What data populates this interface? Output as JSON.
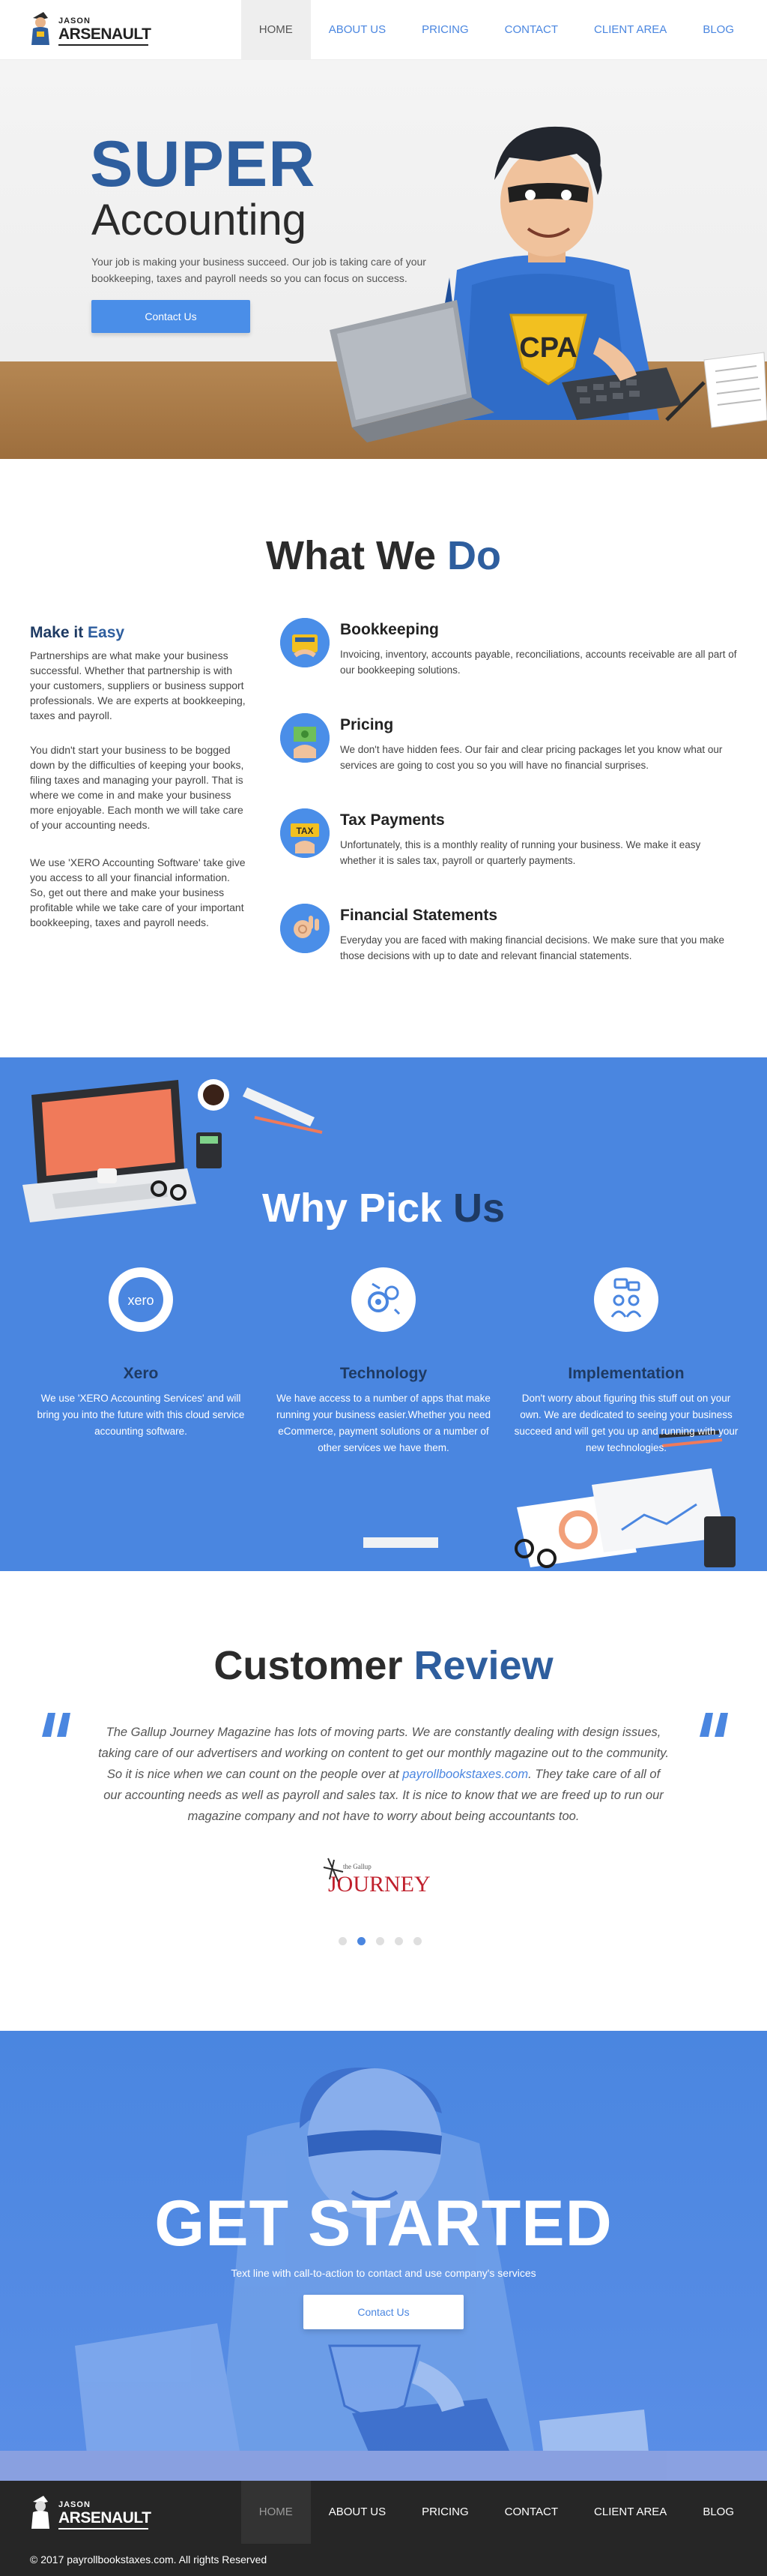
{
  "header": {
    "logo": {
      "first": "JASON",
      "last": "ARSENAULT"
    },
    "nav": [
      {
        "label": "HOME",
        "active": true
      },
      {
        "label": "ABOUT US"
      },
      {
        "label": "PRICING"
      },
      {
        "label": "CONTACT"
      },
      {
        "label": "CLIENT AREA"
      },
      {
        "label": "BLOG"
      }
    ]
  },
  "hero": {
    "title_1": "SUPER",
    "title_2": "Accounting",
    "text": "Your job is making your business succeed. Our job is taking care of your bookkeeping, taxes and payroll needs so you can focus on success.",
    "button": "Contact Us",
    "badge": "CPA"
  },
  "what_we_do": {
    "title_dark": "What We ",
    "title_blue": "Do",
    "easy_title": "Make it ",
    "easy_title_blue": "Easy",
    "paragraphs": [
      "Partnerships are what make your business successful. Whether that partnership is with your customers, suppliers or business support professionals. We are experts at bookkeeping, taxes and payroll.",
      "You didn't start your business to be bogged down by the difficulties of keeping your books, filing taxes and managing your payroll. That is where we come in and make your business more enjoyable. Each month we will take care of your accounting needs.",
      "We use 'XERO Accounting Software' take give you access to all your financial information. So, get out there and make your business profitable while we take care of your important bookkeeping, taxes and payroll needs."
    ],
    "services": [
      {
        "title": "Bookkeeping",
        "desc": "Invoicing, inventory, accounts payable, reconciliations, accounts receivable are all part of our bookkeeping solutions.",
        "icon": "bookkeeping-icon"
      },
      {
        "title": "Pricing",
        "desc": "We don't have hidden fees. Our fair and clear pricing packages let you know what our services are going to cost you so you will have no financial surprises.",
        "icon": "pricing-icon"
      },
      {
        "title": "Tax Payments",
        "desc": "Unfortunately, this is a monthly reality of running your business. We make it easy whether it is sales tax, payroll or quarterly payments.",
        "icon": "tax-payments-icon",
        "icon_text": "TAX"
      },
      {
        "title": "Financial Statements",
        "desc": "Everyday you are faced with making financial decisions. We make sure that you make those decisions with up to date and relevant financial statements.",
        "icon": "financial-statements-icon"
      }
    ]
  },
  "why_pick_us": {
    "title_white": "Why Pick ",
    "title_dark": "Us",
    "features": [
      {
        "title": "Xero",
        "desc": "We use 'XERO Accounting Services' and will bring you into the future with this cloud service accounting software.",
        "icon": "xero-logo-icon",
        "icon_text": "xero"
      },
      {
        "title": "Technology",
        "desc": "We have access to a number of apps that make running your business easier.Whether you need eCommerce, payment solutions or a number of other services we have them.",
        "icon": "technology-gears-icon"
      },
      {
        "title": "Implementation",
        "desc": "Don't worry about figuring this stuff out on your own. We are dedicated to seeing your business succeed and will get you up and running with your new technologies.",
        "icon": "implementation-people-icon"
      }
    ]
  },
  "review": {
    "title_dark": "Customer ",
    "title_blue": "Review",
    "text_before": "The Gallup Journey Magazine has lots of moving parts. We are constantly dealing with design issues, taking care of our advertisers and working on content to get our monthly magazine out to the community. So it is nice when we can count on the people over at ",
    "link": "payrollbookstaxes.com",
    "text_after": ". They take care of all of our accounting needs as well as payroll and sales tax. It is nice to know that we are freed up to run our magazine company and not have to worry about being accountants too.",
    "logo_text": "JOURNEY",
    "logo_small": "the Gallup",
    "dots": 5,
    "active_dot": 2
  },
  "get_started": {
    "title": "GET STARTED",
    "subtitle": "Text line with call-to-action to contact and use company's services",
    "button": "Contact Us"
  },
  "footer": {
    "nav": [
      {
        "label": "HOME",
        "active": true
      },
      {
        "label": "ABOUT US"
      },
      {
        "label": "PRICING"
      },
      {
        "label": "CONTACT"
      },
      {
        "label": "CLIENT AREA"
      },
      {
        "label": "BLOG"
      }
    ],
    "copyright": "© 2017 payrollbookstaxes.com. All rights Reserved"
  },
  "colors": {
    "primary": "#4a86e0",
    "navy": "#2e5e9e",
    "dark_navy": "#1e3a63",
    "desk": "#a97944",
    "footer": "#262626"
  }
}
